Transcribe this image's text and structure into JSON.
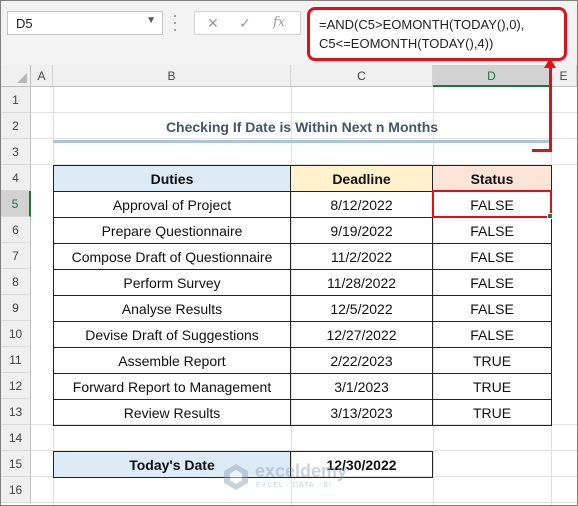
{
  "name_box": {
    "value": "D5"
  },
  "formula_bar": {
    "cancel_symbol": "✕",
    "enter_symbol": "✓",
    "fx_symbol": "fx",
    "formula": "=AND(C5>EOMONTH(TODAY(),0),\nC5<=EOMONTH(TODAY(),4))"
  },
  "columns": [
    "A",
    "B",
    "C",
    "D",
    "E"
  ],
  "selected_column": "D",
  "rows": [
    "1",
    "2",
    "3",
    "4",
    "5",
    "6",
    "7",
    "8",
    "9",
    "10",
    "11",
    "12",
    "13",
    "14",
    "15",
    "16"
  ],
  "selected_row": "5",
  "title": "Checking If Date is Within Next n Months",
  "table": {
    "headers": [
      "Duties",
      "Deadline",
      "Status"
    ],
    "rows": [
      {
        "duty": "Approval of Project",
        "deadline": "8/12/2022",
        "status": "FALSE"
      },
      {
        "duty": "Prepare Questionnaire",
        "deadline": "9/19/2022",
        "status": "FALSE"
      },
      {
        "duty": "Compose Draft of Questionnaire",
        "deadline": "11/2/2022",
        "status": "FALSE"
      },
      {
        "duty": "Perform Survey",
        "deadline": "11/28/2022",
        "status": "FALSE"
      },
      {
        "duty": "Analyse Results",
        "deadline": "12/5/2022",
        "status": "FALSE"
      },
      {
        "duty": "Devise Draft of Suggestions",
        "deadline": "12/27/2022",
        "status": "FALSE"
      },
      {
        "duty": "Assemble Report",
        "deadline": "2/22/2023",
        "status": "TRUE"
      },
      {
        "duty": "Forward Report to Management",
        "deadline": "3/1/2023",
        "status": "TRUE"
      },
      {
        "duty": "Review Results",
        "deadline": "3/13/2023",
        "status": "TRUE"
      }
    ]
  },
  "today": {
    "label": "Today's Date",
    "value": "12/30/2022"
  },
  "watermark": {
    "name": "exceldemy",
    "tagline": "EXCEL · DATA · BI"
  },
  "colors": {
    "highlight": "#e0101a",
    "excel_green": "#217346",
    "title": "#44546a"
  }
}
